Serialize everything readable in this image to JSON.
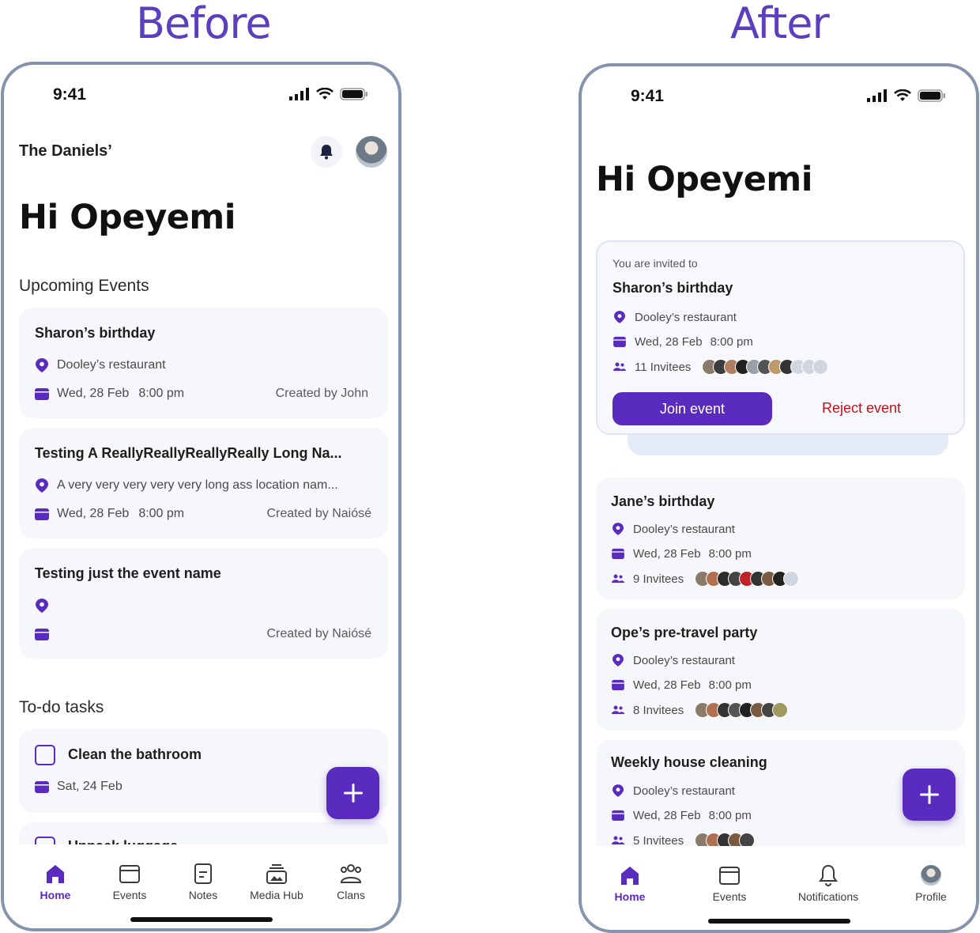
{
  "colors": {
    "accent": "#5a2bbf",
    "heading": "#5b3fbf",
    "reject": "#c0121c",
    "frame": "#8593ad"
  },
  "headings": {
    "before": "Before",
    "after": "After"
  },
  "before": {
    "status_time": "9:41",
    "family_name": "The Daniels’",
    "greeting": "Hi Opeyemi",
    "events_section": "Upcoming Events",
    "events": [
      {
        "title": "Sharon’s birthday",
        "location": "Dooley’s restaurant",
        "date": "Wed, 28 Feb",
        "time": "8:00 pm",
        "creator": "Created by John"
      },
      {
        "title": "Testing A ReallyReallyReallyReally Long Na...",
        "location": "A very very very very very long ass location nam...",
        "date": "Wed, 28 Feb",
        "time": "8:00 pm",
        "creator": "Created by Naiósé"
      },
      {
        "title": "Testing just the event name",
        "location": "",
        "date": "",
        "time": "",
        "creator": "Created by Naiósé"
      }
    ],
    "tasks_section": "To-do tasks",
    "tasks": [
      {
        "title": "Clean the bathroom",
        "date": "Sat, 24 Feb"
      },
      {
        "title": "Unpack luggage"
      }
    ],
    "tabs": [
      "Home",
      "Events",
      "Notes",
      "Media Hub",
      "Clans"
    ]
  },
  "after": {
    "status_time": "9:41",
    "greeting": "Hi Opeyemi",
    "invite": {
      "label": "You are invited to",
      "title": "Sharon’s birthday",
      "location": "Dooley’s restaurant",
      "date": "Wed, 28 Feb",
      "time": "8:00 pm",
      "invitees": "11 Invitees",
      "join": "Join event",
      "reject": "Reject event"
    },
    "events": [
      {
        "title": "Jane’s birthday",
        "location": "Dooley’s restaurant",
        "date": "Wed, 28 Feb",
        "time": "8:00 pm",
        "invitees": "9 Invitees"
      },
      {
        "title": "Ope’s pre-travel party",
        "location": "Dooley’s restaurant",
        "date": "Wed, 28 Feb",
        "time": "8:00 pm",
        "invitees": "8 Invitees"
      },
      {
        "title": "Weekly house cleaning",
        "location": "Dooley’s restaurant",
        "date": "Wed, 28 Feb",
        "time": "8:00 pm",
        "invitees": "5 Invitees"
      }
    ],
    "tabs": [
      "Home",
      "Events",
      "Notifications",
      "Profile"
    ]
  }
}
